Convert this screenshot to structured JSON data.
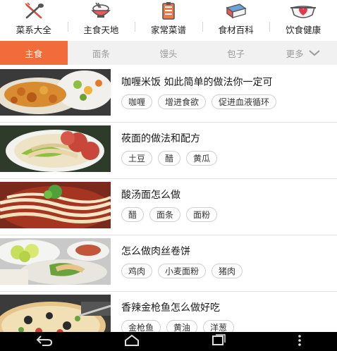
{
  "top_nav": [
    {
      "label": "菜系大全",
      "icon": "fork-spoon-icon"
    },
    {
      "label": "主食天地",
      "icon": "rice-bowl-icon"
    },
    {
      "label": "家常菜谱",
      "icon": "notebook-icon"
    },
    {
      "label": "食材百科",
      "icon": "book-icon"
    },
    {
      "label": "饮食健康",
      "icon": "heart-pot-icon"
    }
  ],
  "tabs": [
    {
      "label": "主食",
      "active": true
    },
    {
      "label": "面条",
      "active": false
    },
    {
      "label": "馒头",
      "active": false
    },
    {
      "label": "包子",
      "active": false
    },
    {
      "label": "更多",
      "active": false
    }
  ],
  "recipes": [
    {
      "title": "咖喱米饭 如此简单的做法你一定可",
      "tags": [
        "咖喱",
        "增进食欲",
        "促进血液循环"
      ],
      "image": "curry-rice-photo"
    },
    {
      "title": "莜面的做法和配方",
      "tags": [
        "土豆",
        "醋",
        "黄瓜"
      ],
      "image": "oat-noodle-photo"
    },
    {
      "title": "酸汤面怎么做",
      "tags": [
        "醋",
        "面条",
        "面粉"
      ],
      "image": "sour-soup-noodle-photo"
    },
    {
      "title": "怎么做肉丝卷饼",
      "tags": [
        "鸡肉",
        "小麦面粉",
        "猪肉"
      ],
      "image": "shredded-meat-wrap-photo"
    },
    {
      "title": "香辣金枪鱼怎么做好吃",
      "tags": [
        "金枪鱼",
        "黄油",
        "洋葱"
      ],
      "image": "spicy-tuna-pizza-photo"
    }
  ],
  "colors": {
    "accent": "#f26c3b",
    "tab_bg": "#f1f1f1",
    "nav_bar": "#000000"
  },
  "system_nav": [
    {
      "name": "back-icon"
    },
    {
      "name": "home-icon"
    },
    {
      "name": "recents-icon"
    },
    {
      "name": "overflow-menu-icon"
    }
  ]
}
